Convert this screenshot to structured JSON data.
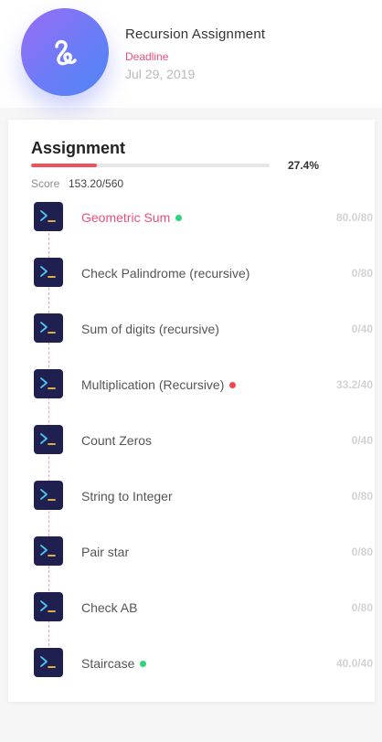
{
  "header": {
    "logo_icon": "squiggle-icon",
    "title": "Recursion Assignment",
    "deadline_label": "Deadline",
    "deadline_date": "Jul 29, 2019"
  },
  "assignment": {
    "heading": "Assignment",
    "progress_percent": 27.4,
    "progress_text": "27.4%",
    "score_label": "Score",
    "score_value": "153.20/560",
    "colors": {
      "accent": "#ec4d7a",
      "progress": "#ef4f58",
      "icon_bg": "#1f2050"
    },
    "items": [
      {
        "name": "Geometric Sum",
        "score": "80.0/80",
        "status": "green",
        "active": true
      },
      {
        "name": "Check Palindrome (recursive)",
        "score": "0/80",
        "status": null,
        "active": false
      },
      {
        "name": "Sum of digits (recursive)",
        "score": "0/40",
        "status": null,
        "active": false
      },
      {
        "name": "Multiplication (Recursive)",
        "score": "33.2/40",
        "status": "red",
        "active": false
      },
      {
        "name": "Count Zeros",
        "score": "0/40",
        "status": null,
        "active": false
      },
      {
        "name": "String to Integer",
        "score": "0/80",
        "status": null,
        "active": false
      },
      {
        "name": "Pair star",
        "score": "0/80",
        "status": null,
        "active": false
      },
      {
        "name": "Check AB",
        "score": "0/80",
        "status": null,
        "active": false
      },
      {
        "name": "Staircase",
        "score": "40.0/40",
        "status": "green",
        "active": false
      }
    ]
  }
}
